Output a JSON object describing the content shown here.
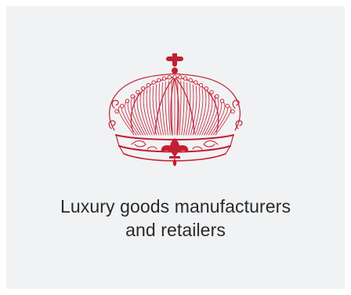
{
  "card": {
    "logo_icon": "crown-icon",
    "caption_line_1": "Luxury goods manufacturers",
    "caption_line_2": "and retailers"
  },
  "colors": {
    "background": "#f1f2f4",
    "crown": "#c21f32",
    "text": "#2a2a2a"
  }
}
